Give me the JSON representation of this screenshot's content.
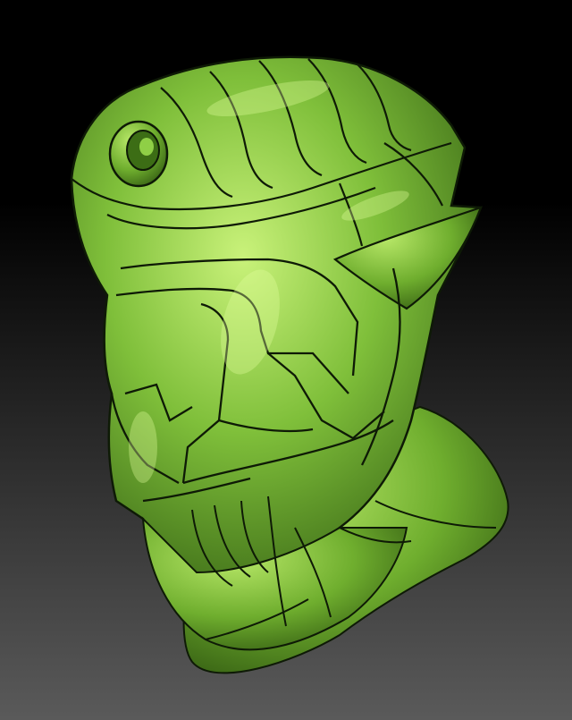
{
  "scene": {
    "subject": "sculpted-armored-head",
    "material_color": "#7fbf3a",
    "highlight_color": "#c9f27a",
    "shadow_color": "#2f5a10",
    "line_color": "#0e1a06",
    "background_top": "#000000",
    "background_bottom": "#5a5a5a"
  }
}
